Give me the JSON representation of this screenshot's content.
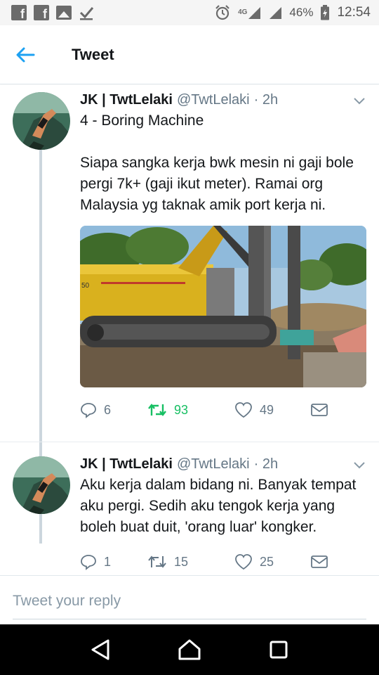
{
  "status_bar": {
    "network": "4G",
    "battery": "46%",
    "time": "12:54",
    "left_icons": [
      "facebook-icon",
      "facebook-icon",
      "gallery-icon",
      "check-icon"
    ],
    "right_icons": [
      "alarm-icon",
      "signal-icon",
      "signal-icon",
      "battery-icon"
    ]
  },
  "header": {
    "title": "Tweet",
    "back_icon": "arrow-left-icon"
  },
  "colors": {
    "accent": "#1da1f2",
    "retweet": "#17bf63",
    "secondary_text": "#657786",
    "thread_line": "#ccd6dd"
  },
  "tweets": [
    {
      "name": "JK | TwtLelaki",
      "handle": "@TwtLelaki",
      "time": "· 2h",
      "text": "4 - Boring Machine\n\nSiapa sangka kerja bwk mesin ni gaji bole pergi 7k+ (gaji ikut meter). Ramai org Malaysia yg taknak amik port kerja ni.",
      "has_media": true,
      "replies": "6",
      "retweets": "93",
      "likes": "49",
      "retweeted": true
    },
    {
      "name": "JK | TwtLelaki",
      "handle": "@TwtLelaki",
      "time": "· 2h",
      "text": "Aku kerja dalam bidang ni. Banyak tempat aku pergi. Sedih aku tengok kerja yang boleh buat duit, 'orang luar' kongker.",
      "has_media": false,
      "replies": "1",
      "retweets": "15",
      "likes": "25",
      "retweeted": false
    }
  ],
  "reply": {
    "placeholder": "Tweet your reply",
    "value": ""
  },
  "nav": {
    "buttons": [
      "back-triangle-icon",
      "home-circle-icon",
      "recents-square-icon"
    ]
  }
}
